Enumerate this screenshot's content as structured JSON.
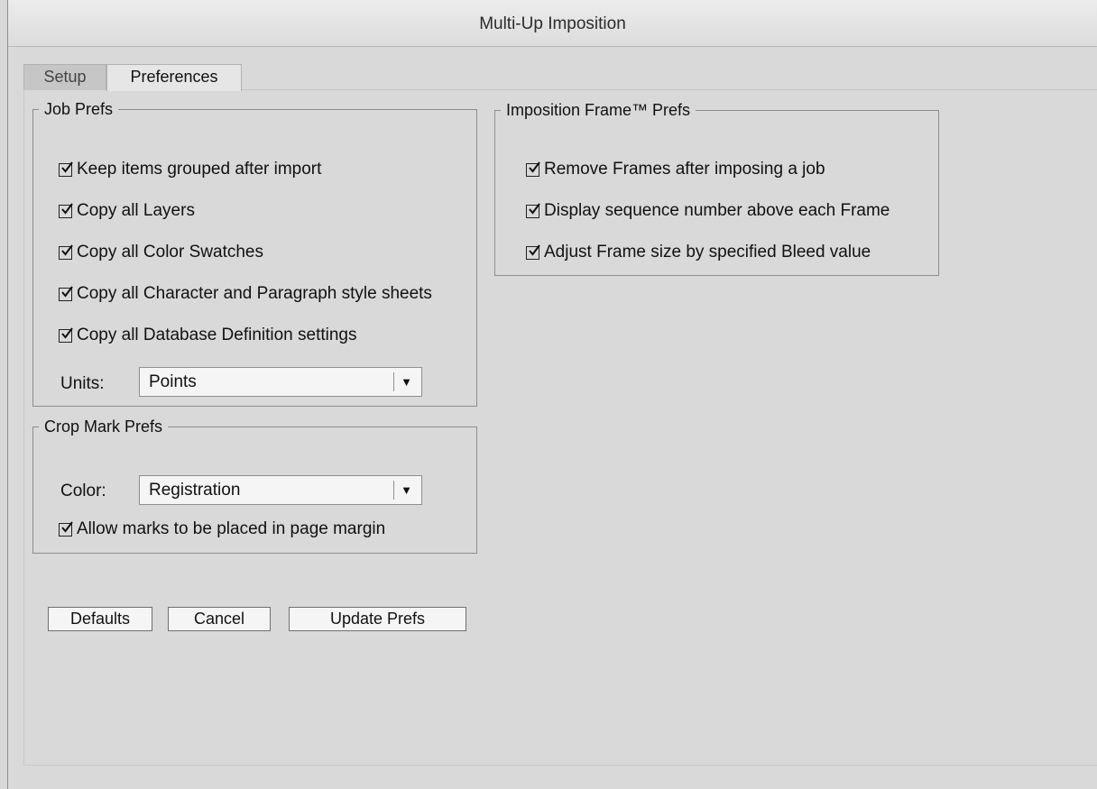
{
  "window": {
    "title": "Multi-Up Imposition"
  },
  "tabs": [
    {
      "label": "Setup",
      "active": false
    },
    {
      "label": "Preferences",
      "active": true
    }
  ],
  "job_prefs": {
    "legend": "Job Prefs",
    "options": [
      {
        "label": "Keep items grouped after import",
        "checked": true
      },
      {
        "label": "Copy all Layers",
        "checked": true
      },
      {
        "label": "Copy all Color Swatches",
        "checked": true
      },
      {
        "label": "Copy all Character and Paragraph style sheets",
        "checked": true
      },
      {
        "label": "Copy all Database Definition settings",
        "checked": true
      }
    ],
    "units": {
      "label": "Units:",
      "value": "Points"
    }
  },
  "crop_prefs": {
    "legend": "Crop Mark Prefs",
    "color": {
      "label": "Color:",
      "value": "Registration"
    },
    "options": [
      {
        "label": "Allow marks to be placed in page margin",
        "checked": true
      }
    ]
  },
  "frame_prefs": {
    "legend": "Imposition Frame™ Prefs",
    "options": [
      {
        "label": "Remove Frames after imposing a job",
        "checked": true
      },
      {
        "label": "Display sequence number above each Frame",
        "checked": true
      },
      {
        "label": "Adjust Frame size by specified Bleed value",
        "checked": true
      }
    ]
  },
  "buttons": {
    "defaults": "Defaults",
    "cancel": "Cancel",
    "update": "Update Prefs"
  },
  "icons": {
    "checkmark": "checkmark-icon",
    "dropdown": "▼"
  }
}
